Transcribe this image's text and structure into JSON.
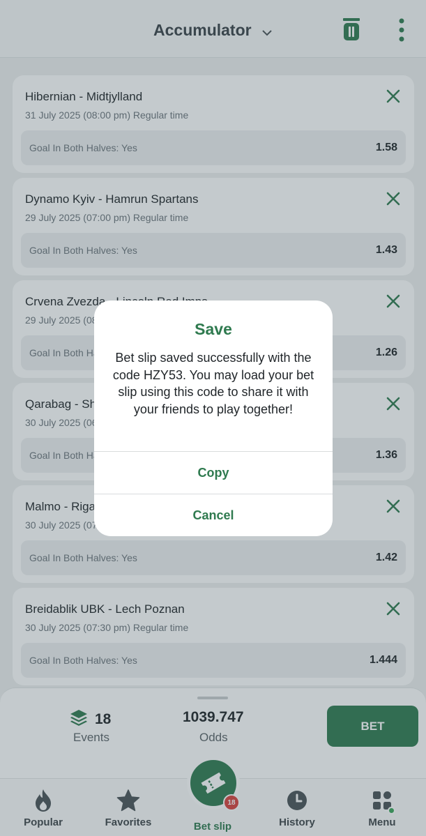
{
  "header": {
    "title": "Accumulator"
  },
  "bets": [
    {
      "match": "Hibernian - Midtjylland",
      "when": "31 July 2025 (08:00 pm) Regular time",
      "market": "Goal In Both Halves: Yes",
      "odds": "1.58"
    },
    {
      "match": "Dynamo Kyiv - Hamrun Spartans",
      "when": "29 July 2025 (07:00 pm) Regular time",
      "market": "Goal In Both Halves: Yes",
      "odds": "1.43"
    },
    {
      "match": "Crvena Zvezda - Lincoln Red Imps",
      "when": "29 July 2025 (08:30 pm) Regular time",
      "market": "Goal In Both Halves: Yes",
      "odds": "1.26"
    },
    {
      "match": "Qarabag - Shelbourne",
      "when": "30 July 2025 (06:00 pm) Regular time",
      "market": "Goal In Both Halves: Yes",
      "odds": "1.36"
    },
    {
      "match": "Malmo - Riga",
      "when": "30 July 2025 (07:00 pm) Regular time",
      "market": "Goal In Both Halves: Yes",
      "odds": "1.42"
    },
    {
      "match": "Breidablik UBK - Lech Poznan",
      "when": "30 July 2025 (07:30 pm) Regular time",
      "market": "Goal In Both Halves: Yes",
      "odds": "1.444"
    }
  ],
  "summary": {
    "events_count": "18",
    "events_label": "Events",
    "odds_total": "1039.747",
    "odds_label": "Odds",
    "bet_label": "BET"
  },
  "nav": {
    "popular": "Popular",
    "favorites": "Favorites",
    "betslip": "Bet slip",
    "betslip_badge": "18",
    "history": "History",
    "menu": "Menu"
  },
  "dialog": {
    "title": "Save",
    "message": "Bet slip saved successfully with the code HZY53. You may load your bet slip using this code to share it with your friends to play together!",
    "copy_label": "Copy",
    "cancel_label": "Cancel"
  },
  "colors": {
    "brand_green": "#2f7a4f",
    "badge_red": "#d8413d"
  }
}
